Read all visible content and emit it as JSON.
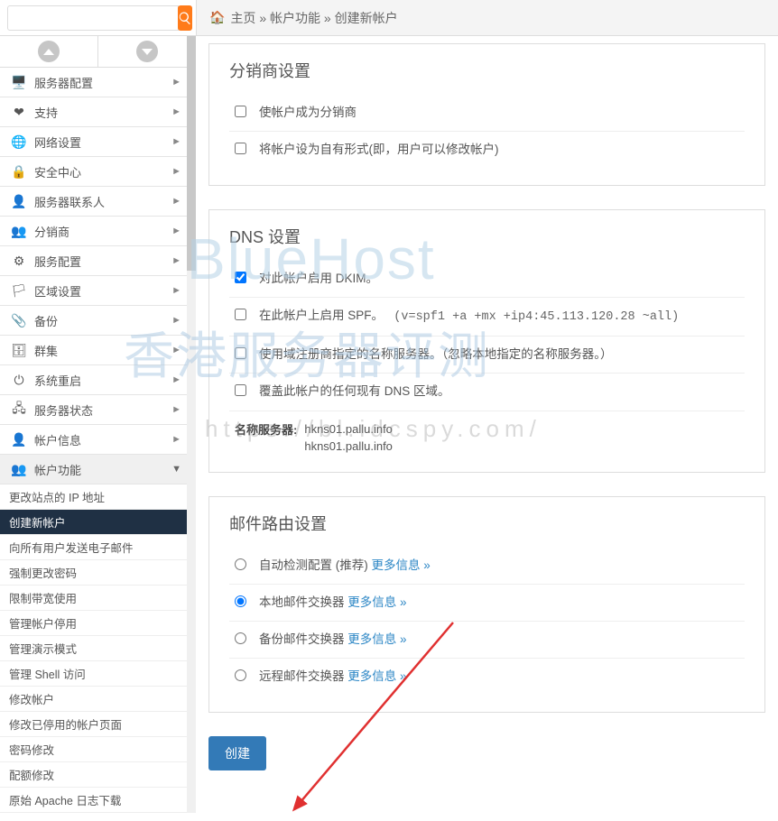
{
  "search": {
    "placeholder": ""
  },
  "breadcrumb": {
    "home": "主页",
    "l1": "帐户功能",
    "l2": "创建新帐户"
  },
  "sidebar": {
    "cats": [
      {
        "label": "服务器配置",
        "icon": "🖥️"
      },
      {
        "label": "支持",
        "icon": "❤"
      },
      {
        "label": "网络设置",
        "icon": "🌐"
      },
      {
        "label": "安全中心",
        "icon": "🔒"
      },
      {
        "label": "服务器联系人",
        "icon": "👤"
      },
      {
        "label": "分销商",
        "icon": "👥"
      },
      {
        "label": "服务配置",
        "icon": "⚙"
      },
      {
        "label": "区域设置",
        "icon": "🏳"
      },
      {
        "label": "备份",
        "icon": "📎"
      },
      {
        "label": "群集",
        "icon": "🗄"
      },
      {
        "label": "系统重启",
        "icon": "⏻"
      },
      {
        "label": "服务器状态",
        "icon": "🖧"
      },
      {
        "label": "帐户信息",
        "icon": "👤"
      },
      {
        "label": "帐户功能",
        "icon": "👥"
      }
    ],
    "items": [
      "更改站点的 IP 地址",
      "创建新帐户",
      "向所有用户发送电子邮件",
      "强制更改密码",
      "限制带宽使用",
      "管理帐户停用",
      "管理演示模式",
      "管理 Shell 访问",
      "修改帐户",
      "修改已停用的帐户页面",
      "密码修改",
      "配额修改",
      "原始 Apache 日志下载"
    ],
    "active_index": 1
  },
  "panels": {
    "reseller": {
      "title": "分销商设置",
      "opt1": "使帐户成为分销商",
      "opt2": "将帐户设为自有形式(即，用户可以修改帐户)"
    },
    "dns": {
      "title": "DNS 设置",
      "dkim": "对此帐户启用 DKIM。",
      "spf_a": "在此帐户上启用 SPF。",
      "spf_b": "(v=spf1 +a +mx +ip4:45.113.120.28 ~all)",
      "registrar": "使用域注册商指定的名称服务器。（忽略本地指定的名称服务器。）",
      "override": "覆盖此帐户的任何现有 DNS 区域。",
      "ns_label": "名称服务器:",
      "ns1": "hkns01.pallu.info",
      "ns2": "hkns01.pallu.info"
    },
    "mail": {
      "title": "邮件路由设置",
      "auto": "自动检测配置 (推荐)",
      "local": "本地邮件交换器",
      "backup": "备份邮件交换器",
      "remote": "远程邮件交换器",
      "more": "更多信息 »"
    }
  },
  "buttons": {
    "create": "创建"
  },
  "watermarks": {
    "w1": "BlueHost",
    "w2": "香港服务器评测",
    "w3": "https://bl.idcspy.com/"
  }
}
